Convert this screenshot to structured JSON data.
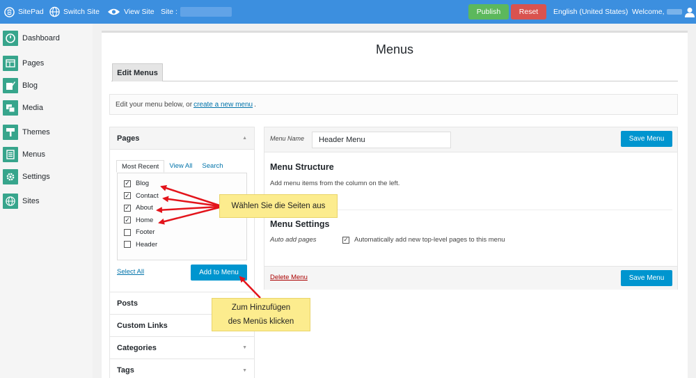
{
  "topbar": {
    "app_name": "SitePad",
    "switch_site": "Switch Site",
    "view_site": "View Site",
    "site_label": "Site :",
    "publish": "Publish",
    "reset": "Reset",
    "language": "English (United States)",
    "welcome": "Welcome,"
  },
  "sidebar": {
    "items": [
      {
        "label": "Dashboard",
        "icon": "dashboard-icon"
      },
      {
        "label": "Pages",
        "icon": "pages-icon"
      },
      {
        "label": "Blog",
        "icon": "blog-icon"
      },
      {
        "label": "Media",
        "icon": "media-icon"
      },
      {
        "label": "Themes",
        "icon": "themes-icon"
      },
      {
        "label": "Menus",
        "icon": "menus-icon"
      },
      {
        "label": "Settings",
        "icon": "settings-icon"
      },
      {
        "label": "Sites",
        "icon": "sites-icon"
      }
    ]
  },
  "main": {
    "title": "Menus",
    "tab": "Edit Menus",
    "notice_prefix": "Edit your menu below, or",
    "notice_link": "create a new menu",
    "notice_suffix": "."
  },
  "pages_box": {
    "title": "Pages",
    "tabs": [
      "Most Recent",
      "View All",
      "Search"
    ],
    "items": [
      {
        "label": "Blog",
        "checked": true
      },
      {
        "label": "Contact",
        "checked": true
      },
      {
        "label": "About",
        "checked": true
      },
      {
        "label": "Home",
        "checked": true
      },
      {
        "label": "Footer",
        "checked": false
      },
      {
        "label": "Header",
        "checked": false
      }
    ],
    "select_all": "Select All",
    "add_button": "Add to Menu"
  },
  "accordion": {
    "posts": "Posts",
    "custom_links": "Custom Links",
    "categories": "Categories",
    "tags": "Tags"
  },
  "menu_panel": {
    "name_label": "Menu Name",
    "name_value": "Header Menu",
    "save_button": "Save Menu",
    "structure_title": "Menu Structure",
    "structure_text": "Add menu items from the column on the left.",
    "settings_title": "Menu Settings",
    "auto_add_label": "Auto add pages",
    "auto_add_text": "Automatically add new top-level pages to this menu",
    "delete": "Delete Menu"
  },
  "callouts": {
    "select_pages": "Wählen Sie die Seiten aus",
    "add_line1": "Zum Hinzufügen",
    "add_line2": "des Menüs klicken"
  },
  "colors": {
    "topbar": "#3c8fdf",
    "accent": "#0095cf",
    "sidebar_icon": "#37a58c",
    "publish": "#5cb85c",
    "reset": "#d9534f",
    "callout": "#fcec8e",
    "arrow": "#e3141b"
  }
}
